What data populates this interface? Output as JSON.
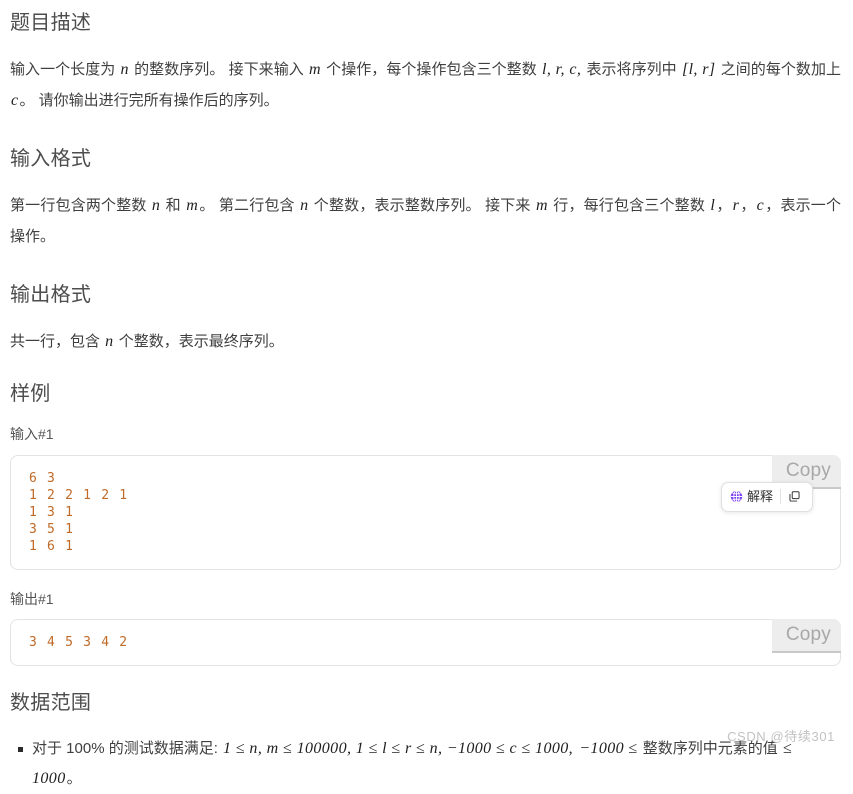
{
  "sections": {
    "description": {
      "heading": "题目描述",
      "text_parts": {
        "p1_a": "输入一个长度为 ",
        "p1_m1": "n",
        "p1_b": " 的整数序列。 接下来输入 ",
        "p1_m2": "m",
        "p1_c": " 个操作，每个操作包含三个整数 ",
        "p1_m3": "l, r, c,",
        "p1_d": " 表示将序列中 ",
        "p1_m4": "[l, r]",
        "p1_e": " 之间的每个数加上 ",
        "p1_m5": "c",
        "p1_f": "。 请你输出进行完所有操作后的序列。"
      }
    },
    "input_format": {
      "heading": "输入格式",
      "text_parts": {
        "a": "第一行包含两个整数 ",
        "m1": "n",
        "b": " 和 ",
        "m2": "m",
        "c": "。 第二行包含 ",
        "m3": "n",
        "d": " 个整数，表示整数序列。 接下来 ",
        "m4": "m",
        "e": " 行，每行包含三个整数 ",
        "m5": "l",
        "f": "，",
        "m6": "r",
        "g": "，",
        "m7": "c",
        "h": "，表示一个操作。"
      }
    },
    "output_format": {
      "heading": "输出格式",
      "text_parts": {
        "a": "共一行，包含 ",
        "m1": "n",
        "b": " 个整数，表示最终序列。"
      }
    },
    "sample": {
      "heading": "样例",
      "input_label": "输入#1",
      "input_code": "6 3\n1 2 2 1 2 1\n1 3 1\n3 5 1\n1 6 1",
      "output_label": "输出#1",
      "output_code": "3 4 5 3 4 2",
      "copy_label": "Copy",
      "explain_label": "解释"
    },
    "data_range": {
      "heading": "数据范围",
      "items": [
        {
          "a": "对于 100% 的测试数据满足: ",
          "m1": "1 ≤ n, m ≤ 100000, 1 ≤ l ≤ r ≤ n, −1000 ≤ c ≤ 1000,",
          "b": "  ",
          "m2": "−1000 ≤",
          "c": " 整数序列中元素的值 ",
          "m3": "≤ 1000",
          "d": "。"
        }
      ]
    }
  },
  "watermark": "CSDN @待续301",
  "colors": {
    "heading": "#4d4d4d",
    "body": "#3f3f3f",
    "code": "#c06a28",
    "accent_purple": "#7a3ff0",
    "copy_tab_bg": "#ededed"
  }
}
